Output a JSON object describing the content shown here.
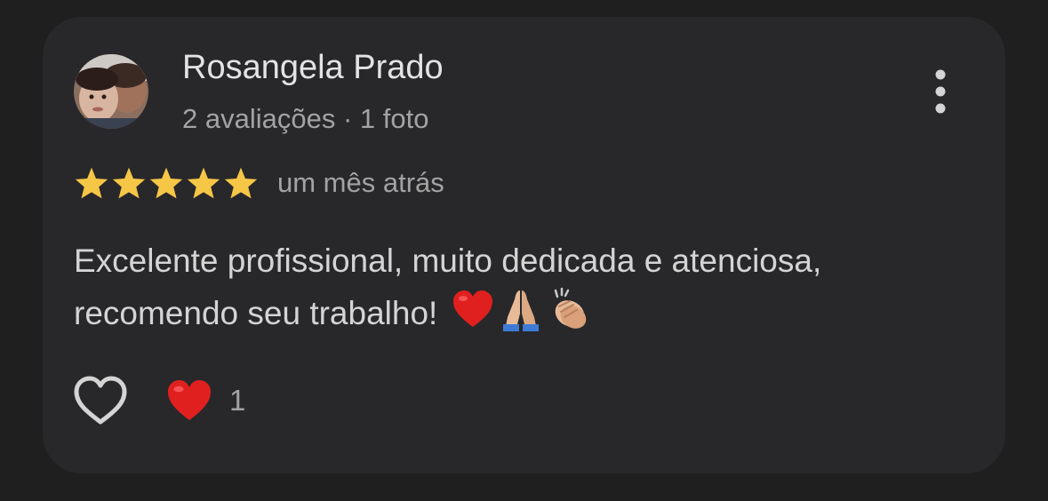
{
  "review": {
    "author_name": "Rosangela Prado",
    "author_meta": "2 avaliações · 1 foto",
    "rating": 5,
    "max_rating": 5,
    "date": "um mês atrás",
    "text_line1": "Excelente profissional, muito dedicada e atenciosa,",
    "text_line2": "recomendo seu trabalho!",
    "emojis": [
      "red-heart",
      "folded-hands",
      "clapping-hands"
    ],
    "reaction_count": "1"
  },
  "icons": {
    "menu": "more-vert-icon",
    "like": "heart-outline-icon",
    "reaction": "red-heart-icon",
    "star": "star-icon"
  },
  "colors": {
    "background": "#1f1f1f",
    "card": "#28282a",
    "star": "#f6c646",
    "heart": "#e0201f",
    "primary_text": "#e3e3e3",
    "secondary_text": "#a3a3a3"
  }
}
